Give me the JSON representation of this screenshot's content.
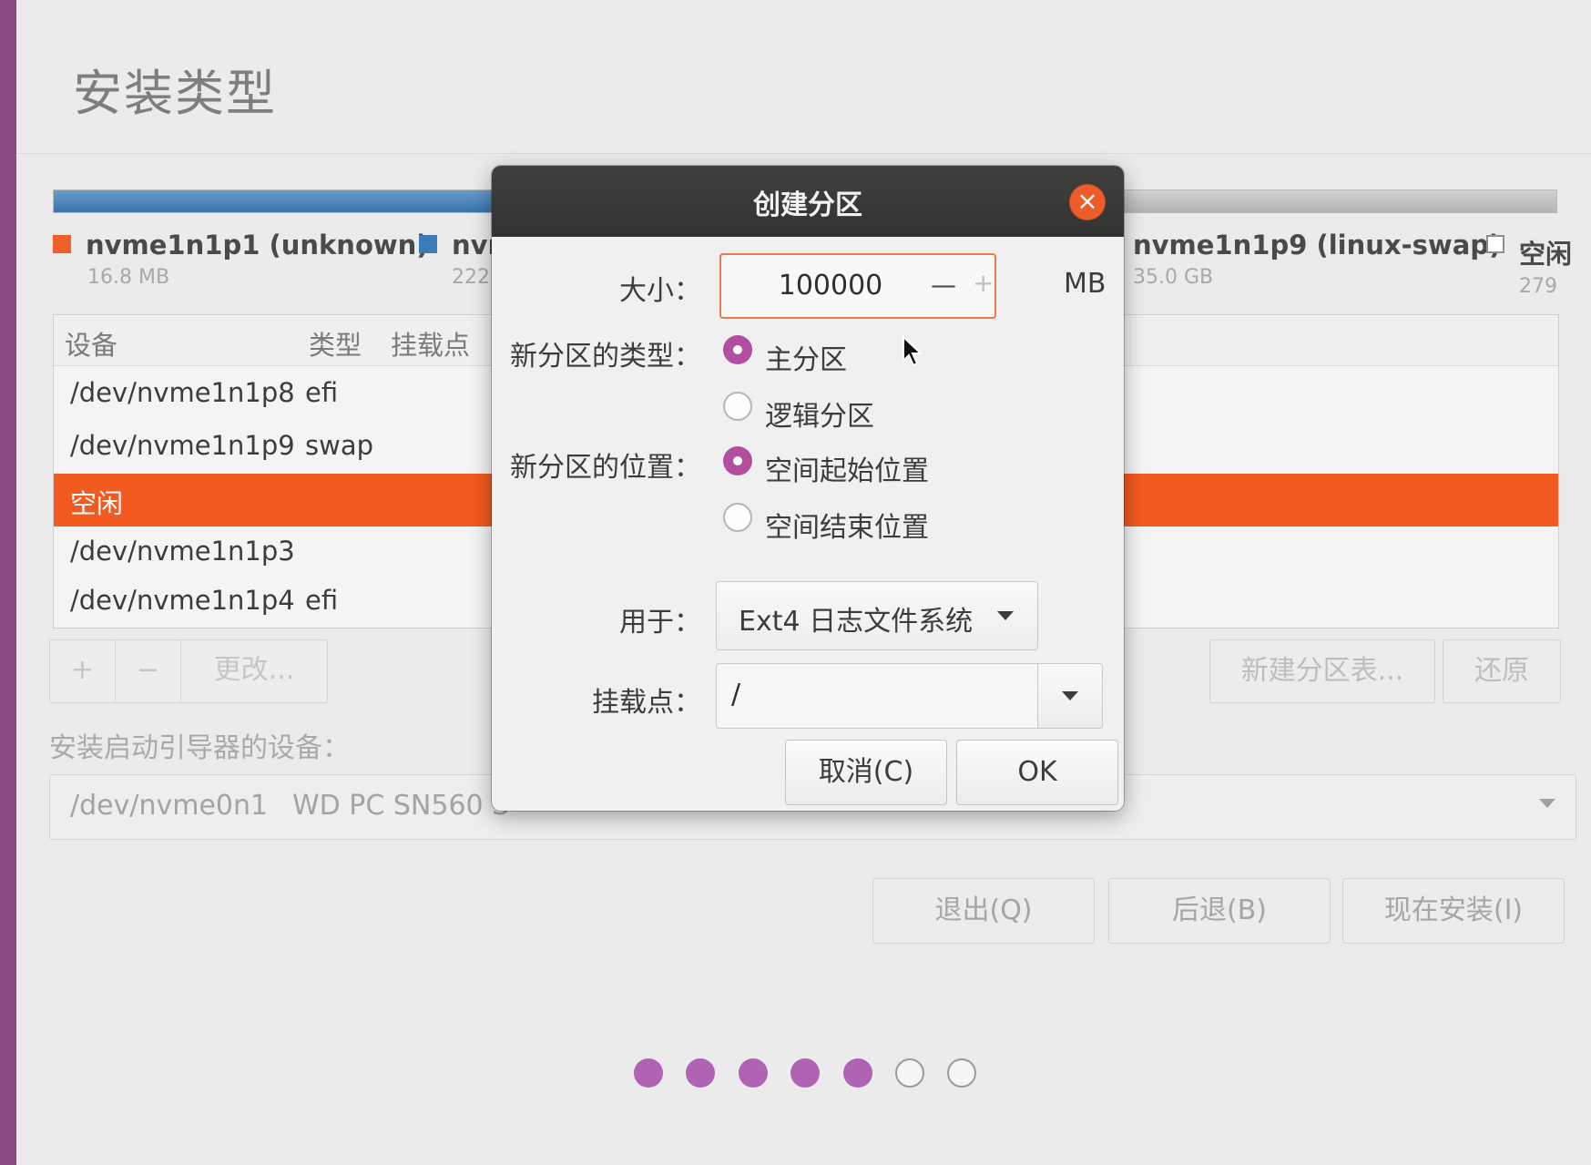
{
  "window": {
    "title": "安装类型"
  },
  "legend": [
    {
      "name": "nvme1n1p1 (unknown)",
      "size": "16.8 MB",
      "color": "#f0612a"
    },
    {
      "name": "nvr",
      "size": "222",
      "color": "#3d7ab8"
    },
    {
      "name": "nvme1n1p9 (linux-swap)",
      "size": "35.0 GB",
      "color": "#c8c8c8"
    },
    {
      "name": "空闲",
      "size": "279",
      "color": "#ffffff"
    }
  ],
  "table": {
    "headers": [
      "设备",
      "类型",
      "挂载点"
    ],
    "rows": [
      {
        "device": "/dev/nvme1n1p8",
        "type": "efi",
        "selected": false
      },
      {
        "device": "/dev/nvme1n1p9",
        "type": "swap",
        "selected": false
      },
      {
        "device": "空闲",
        "type": "",
        "selected": true
      },
      {
        "device": "/dev/nvme1n1p3",
        "type": "",
        "selected": false
      },
      {
        "device": "/dev/nvme1n1p4",
        "type": "efi",
        "selected": false
      }
    ]
  },
  "table_buttons": {
    "add": "+",
    "remove": "−",
    "change": "更改..."
  },
  "new_table_button": "新建分区表...",
  "revert_button": "还原",
  "boot_loader": {
    "label": "安装启动引导器的设备：",
    "device": "/dev/nvme0n1",
    "model": "WD PC SN560 S"
  },
  "nav": {
    "quit": "退出(Q)",
    "back": "后退(B)",
    "install_now": "现在安装(I)"
  },
  "progress": {
    "total_steps": 7,
    "completed_steps": 5
  },
  "dialog": {
    "title": "创建分区",
    "close_icon": "×",
    "size_label": "大小：",
    "size_value": "100000",
    "size_minus": "—",
    "size_plus": "+",
    "size_unit": "MB",
    "type_label": "新分区的类型：",
    "type_options": [
      {
        "label": "主分区",
        "checked": true
      },
      {
        "label": "逻辑分区",
        "checked": false
      }
    ],
    "location_label": "新分区的位置：",
    "location_options": [
      {
        "label": "空间起始位置",
        "checked": true
      },
      {
        "label": "空间结束位置",
        "checked": false
      }
    ],
    "use_label": "用于：",
    "use_value": "Ext4 日志文件系统",
    "mount_label": "挂载点：",
    "mount_value": "/",
    "cancel_button": "取消(C)",
    "ok_button": "OK"
  },
  "colors": {
    "accent": "#f25a20",
    "radio": "#b14e9f",
    "progress_dot": "#b062b3"
  }
}
